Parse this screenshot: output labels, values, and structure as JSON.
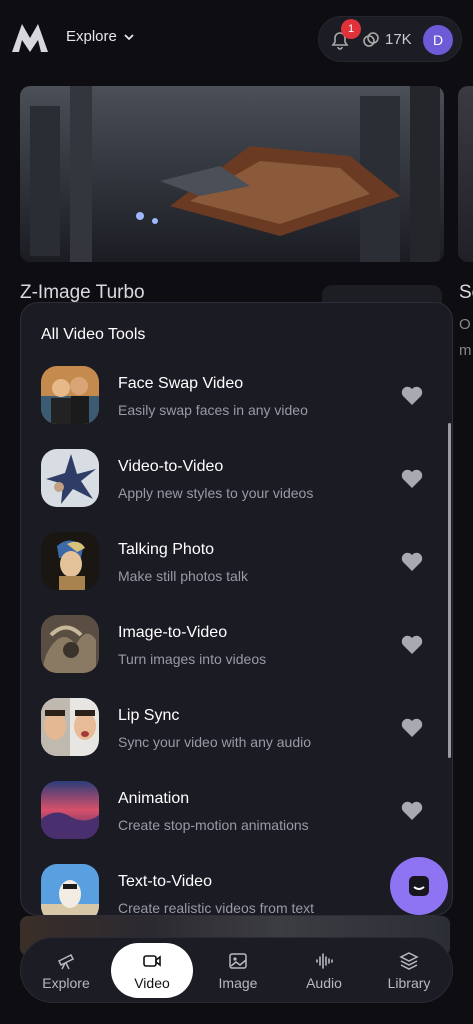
{
  "header": {
    "menu_label": "Explore",
    "notifications_count": "1",
    "credits": "17K",
    "avatar_initial": "D"
  },
  "background": {
    "featured_title": "Z-Image Turbo",
    "side_title": "Se",
    "side_subtitle_1": "O",
    "side_subtitle_2": "m"
  },
  "panel": {
    "title": "All Video Tools",
    "tools": [
      {
        "name": "Face Swap Video",
        "description": "Easily swap faces in any video"
      },
      {
        "name": "Video-to-Video",
        "description": "Apply new styles to your videos"
      },
      {
        "name": "Talking Photo",
        "description": "Make still photos talk"
      },
      {
        "name": "Image-to-Video",
        "description": "Turn images into videos"
      },
      {
        "name": "Lip Sync",
        "description": "Sync your video with any audio"
      },
      {
        "name": "Animation",
        "description": "Create stop-motion animations"
      },
      {
        "name": "Text-to-Video",
        "description": "Create realistic videos from text"
      }
    ]
  },
  "nav": {
    "items": [
      {
        "label": "Explore",
        "icon": "telescope-icon"
      },
      {
        "label": "Video",
        "icon": "video-camera-icon"
      },
      {
        "label": "Image",
        "icon": "image-icon"
      },
      {
        "label": "Audio",
        "icon": "waveform-icon"
      },
      {
        "label": "Library",
        "icon": "layers-icon"
      }
    ],
    "active": "Video"
  },
  "colors": {
    "background": "#0d0d12",
    "panel": "#1b1b24",
    "accent": "#8e74f2",
    "badge": "#e0323a",
    "avatar": "#6c5bd6"
  }
}
